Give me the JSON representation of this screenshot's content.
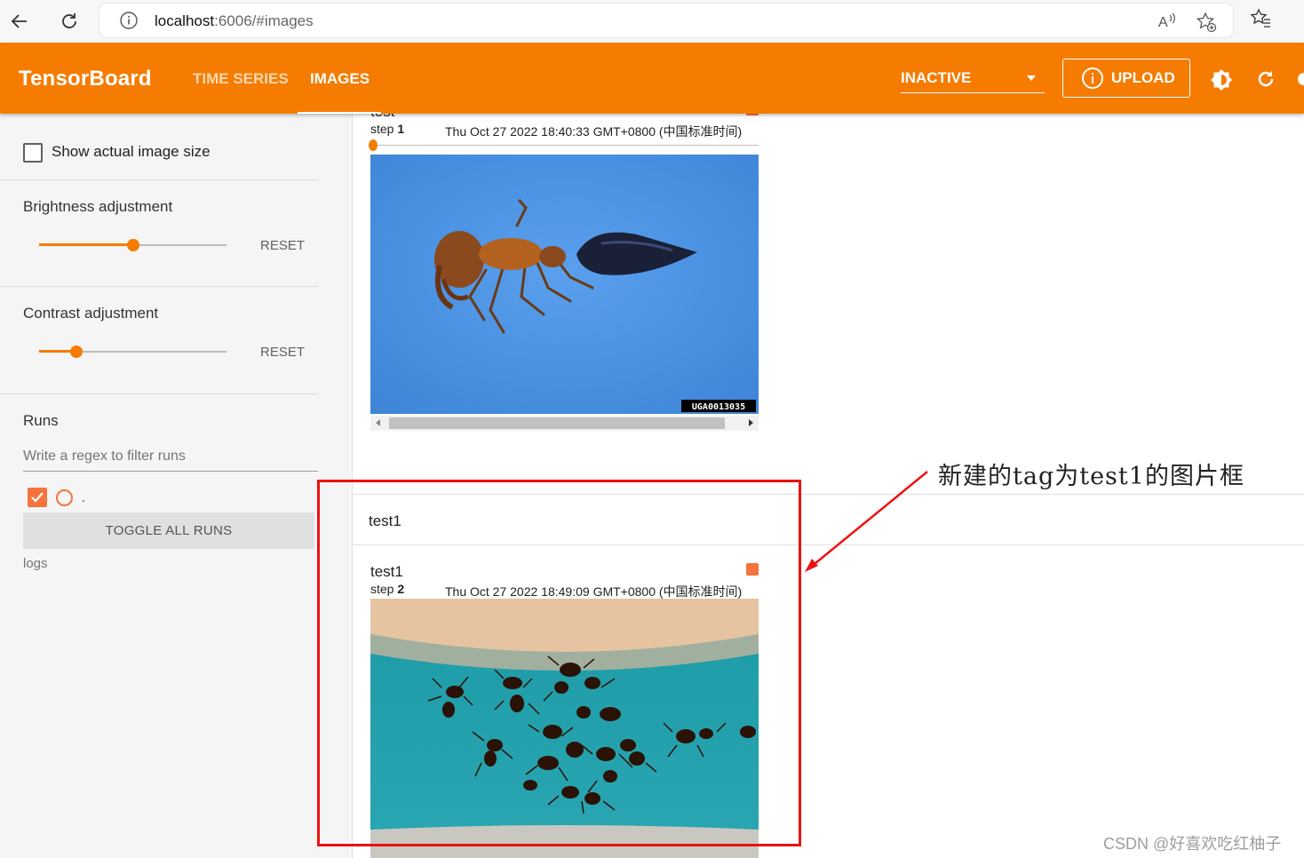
{
  "browser": {
    "url_host": "localhost",
    "url_path": ":6006/#images",
    "icons": [
      "back-arrow-icon",
      "reload-icon",
      "info-icon",
      "read-aloud-icon",
      "add-favorite-icon",
      "favorites-icon"
    ]
  },
  "toolbar": {
    "title": "TensorBoard",
    "tabs": [
      {
        "label": "TIME SERIES"
      },
      {
        "label": "IMAGES",
        "active": true
      }
    ],
    "select_label": "INACTIVE",
    "upload_label": "UPLOAD",
    "accent_color": "#f57c00"
  },
  "sidebar": {
    "show_actual_size": "Show actual image size",
    "brightness_label": "Brightness adjustment",
    "brightness_value": 0.5,
    "contrast_label": "Contrast adjustment",
    "contrast_value": 0.2,
    "reset_label": "RESET",
    "runs_title": "Runs",
    "runs_filter_placeholder": "Write a regex to filter runs",
    "run_name": ".",
    "toggle_all": "TOGGLE ALL RUNS",
    "logs_label": "logs"
  },
  "cards": [
    {
      "title": "test",
      "step_label": "step",
      "step": "1",
      "time": "Thu Oct 27 2022 18:40:33 GMT+0800 (中国标准时间)",
      "image_watermark": "UGA0013035"
    },
    {
      "section": "test1",
      "title": "test1",
      "step_label": "step",
      "step": "2",
      "time": "Thu Oct 27 2022 18:49:09 GMT+0800 (中国标准时间)"
    }
  ],
  "annotation": {
    "text": "新建的tag为test1的图片框",
    "color": "#ee1111"
  },
  "watermark": "CSDN @好喜欢吃红柚子"
}
